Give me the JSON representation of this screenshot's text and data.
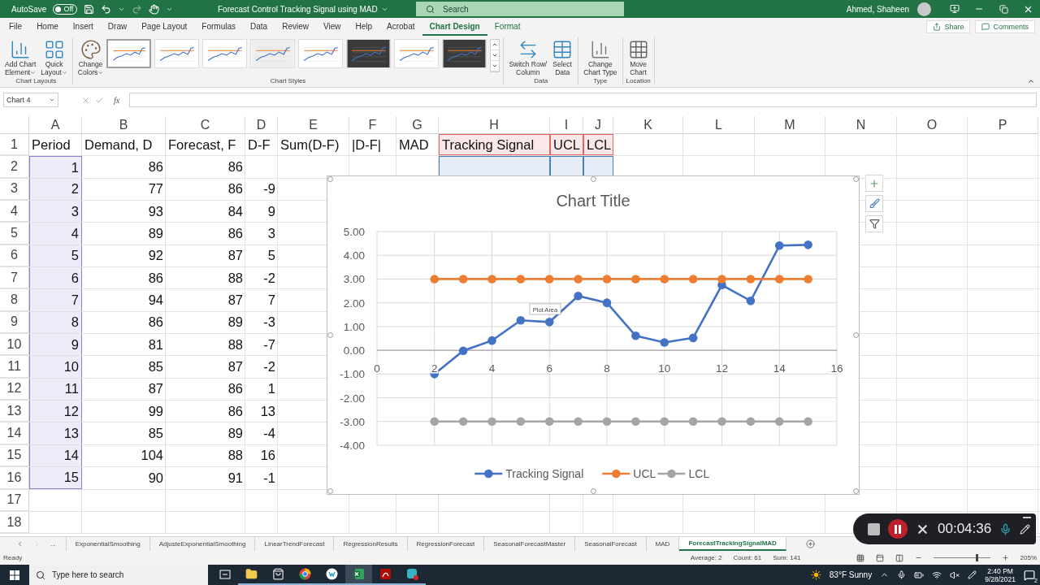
{
  "title_bar": {
    "autosave_label": "AutoSave",
    "autosave": {
      "on": false,
      "label": "Off"
    },
    "title": "Forecast Control Tracking Signal using MAD",
    "search": {
      "placeholder": "Search"
    },
    "user": "Ahmed, Shaheen"
  },
  "menu_tabs": [
    {
      "label": "File",
      "selected": false,
      "kind": "normal"
    },
    {
      "label": "Home",
      "selected": false,
      "kind": "normal"
    },
    {
      "label": "Insert",
      "selected": false,
      "kind": "normal"
    },
    {
      "label": "Draw",
      "selected": false,
      "kind": "normal"
    },
    {
      "label": "Page Layout",
      "selected": false,
      "kind": "normal"
    },
    {
      "label": "Formulas",
      "selected": false,
      "kind": "normal"
    },
    {
      "label": "Data",
      "selected": false,
      "kind": "normal"
    },
    {
      "label": "Review",
      "selected": false,
      "kind": "normal"
    },
    {
      "label": "View",
      "selected": false,
      "kind": "normal"
    },
    {
      "label": "Help",
      "selected": false,
      "kind": "normal"
    },
    {
      "label": "Acrobat",
      "selected": false,
      "kind": "normal"
    },
    {
      "label": "Chart Design",
      "selected": true,
      "kind": "contextual"
    },
    {
      "label": "Format",
      "selected": false,
      "kind": "contextual"
    }
  ],
  "share": "Share",
  "comments": "Comments",
  "ribbon": {
    "groups": [
      {
        "label": "Chart Layouts",
        "commands": [
          {
            "kind": "add-chart",
            "lines": [
              "Add Chart",
              "Element"
            ],
            "dropdown": true
          },
          {
            "kind": "quick-layout",
            "lines": [
              "Quick",
              "Layout"
            ],
            "dropdown": true
          }
        ]
      },
      {
        "label": "Chart Styles",
        "commands": [
          {
            "kind": "colors",
            "lines": [
              "Change",
              "Colors"
            ],
            "dropdown": true
          }
        ],
        "styles": [
          {
            "kind": "light",
            "selected": true
          },
          {
            "kind": "light",
            "selected": false
          },
          {
            "kind": "light",
            "selected": false
          },
          {
            "kind": "shaded",
            "selected": false
          },
          {
            "kind": "light",
            "selected": false
          },
          {
            "kind": "dark",
            "selected": false
          },
          {
            "kind": "light",
            "selected": false
          },
          {
            "kind": "dark",
            "selected": false
          }
        ]
      },
      {
        "label": "Data",
        "commands": [
          {
            "kind": "switch",
            "lines": [
              "Switch Row/",
              "Column"
            ],
            "dropdown": false
          },
          {
            "kind": "select-data",
            "lines": [
              "Select",
              "Data"
            ],
            "dropdown": false
          }
        ]
      },
      {
        "label": "Type",
        "commands": [
          {
            "kind": "chart-type",
            "lines": [
              "Change",
              "Chart Type"
            ],
            "dropdown": false
          }
        ]
      },
      {
        "label": "Location",
        "commands": [
          {
            "kind": "move",
            "lines": [
              "Move",
              "Chart"
            ],
            "dropdown": false
          }
        ]
      }
    ]
  },
  "formula_bar": {
    "name_box": "Chart 4",
    "function_label": "fx"
  },
  "sheet": {
    "columns": [
      {
        "label": "A",
        "color": "#8c7fd0"
      },
      {
        "label": "B"
      },
      {
        "label": "C"
      },
      {
        "label": "D"
      },
      {
        "label": "E"
      },
      {
        "label": "F"
      },
      {
        "label": "G"
      },
      {
        "label": "H",
        "color": "#4a7ebb"
      },
      {
        "label": "I",
        "color": "#4a7ebb"
      },
      {
        "label": "J",
        "color": "#4a7ebb"
      },
      {
        "label": "K"
      },
      {
        "label": "L"
      },
      {
        "label": "M"
      },
      {
        "label": "N"
      },
      {
        "label": "O"
      },
      {
        "label": "P"
      }
    ],
    "rows": [
      {
        "number": "1",
        "kind": "header",
        "cells": [
          {
            "text": "Period"
          },
          {
            "text": "Demand, D"
          },
          {
            "text": "Forecast, F"
          },
          {
            "text": "D-F"
          },
          {
            "text": "Sum(D-F)"
          },
          {
            "text": "|D-F|"
          },
          {
            "text": "MAD"
          },
          {
            "text": "Tracking Signal",
            "color": "#e06666"
          },
          {
            "text": "UCL",
            "color": "#e06666"
          },
          {
            "text": "LCL",
            "color": "#e06666"
          }
        ]
      },
      {
        "number": "2",
        "kind": "data",
        "cells": [
          "1",
          "86",
          "86"
        ]
      },
      {
        "number": "3",
        "kind": "data",
        "cells": [
          "2",
          "77",
          "86",
          "-9"
        ]
      },
      {
        "number": "4",
        "kind": "data",
        "cells": [
          "3",
          "93",
          "84",
          "9"
        ]
      },
      {
        "number": "5",
        "kind": "data",
        "cells": [
          "4",
          "89",
          "86",
          "3"
        ]
      },
      {
        "number": "6",
        "kind": "data",
        "cells": [
          "5",
          "92",
          "87",
          "5"
        ]
      },
      {
        "number": "7",
        "kind": "data",
        "cells": [
          "6",
          "86",
          "88",
          "-2"
        ]
      },
      {
        "number": "8",
        "kind": "data",
        "cells": [
          "7",
          "94",
          "87",
          "7"
        ]
      },
      {
        "number": "9",
        "kind": "data",
        "cells": [
          "8",
          "86",
          "89",
          "-3"
        ]
      },
      {
        "number": "10",
        "kind": "data",
        "cells": [
          "9",
          "81",
          "88",
          "-7"
        ]
      },
      {
        "number": "11",
        "kind": "data",
        "cells": [
          "10",
          "85",
          "87",
          "-2"
        ]
      },
      {
        "number": "12",
        "kind": "data",
        "cells": [
          "11",
          "87",
          "86",
          "1"
        ]
      },
      {
        "number": "13",
        "kind": "data",
        "cells": [
          "12",
          "99",
          "86",
          "13"
        ]
      },
      {
        "number": "14",
        "kind": "data",
        "cells": [
          "13",
          "85",
          "89",
          "-4"
        ]
      },
      {
        "number": "15",
        "kind": "data",
        "cells": [
          "14",
          "104",
          "88",
          "16"
        ]
      },
      {
        "number": "16",
        "kind": "data",
        "cells": [
          "15",
          "90",
          "91",
          "-1"
        ]
      },
      {
        "number": "17"
      },
      {
        "number": "18"
      }
    ]
  },
  "chart": {
    "title": "Chart Title",
    "tooltip": "Plot Area",
    "chart_data": {
      "type": "line",
      "x": [
        2,
        3,
        4,
        5,
        6,
        7,
        8,
        9,
        10,
        11,
        12,
        13,
        14,
        15
      ],
      "series": [
        {
          "name": "Tracking Signal",
          "color": "#4472c4",
          "marker": "circle",
          "values": [
            -1.0,
            -0.02,
            0.41,
            1.26,
            1.19,
            2.29,
            2.0,
            0.61,
            0.33,
            0.52,
            2.75,
            2.08,
            4.41,
            4.44
          ]
        },
        {
          "name": "UCL",
          "color": "#ed7d31",
          "marker": "circle",
          "values": [
            3,
            3,
            3,
            3,
            3,
            3,
            3,
            3,
            3,
            3,
            3,
            3,
            3,
            3
          ]
        },
        {
          "name": "LCL",
          "color": "#a5a5a5",
          "marker": "circle",
          "values": [
            -3,
            -3,
            -3,
            -3,
            -3,
            -3,
            -3,
            -3,
            -3,
            -3,
            -3,
            -3,
            -3,
            -3
          ]
        }
      ],
      "xlim": [
        0,
        16
      ],
      "ylim": [
        -4,
        5
      ],
      "xticks": [
        0,
        2,
        4,
        6,
        8,
        10,
        12,
        14,
        16
      ],
      "yticks": [
        {
          "value": -4,
          "label": "-4.00"
        },
        {
          "value": -3,
          "label": "-3.00"
        },
        {
          "value": -2,
          "label": "-2.00"
        },
        {
          "value": -1,
          "label": "-1.00"
        },
        {
          "value": 0,
          "label": "0.00"
        },
        {
          "value": 1,
          "label": "1.00"
        },
        {
          "value": 2,
          "label": "2.00"
        },
        {
          "value": 3,
          "label": "3.00"
        },
        {
          "value": 4,
          "label": "4.00"
        },
        {
          "value": 5,
          "label": "5.00"
        }
      ],
      "grid": true,
      "legend": true
    }
  },
  "sheet_tabs": {
    "overflow": "...",
    "items": [
      {
        "label": "ExponentialSmoothing",
        "selected": false
      },
      {
        "label": "AdjusteExponentialSmoothing",
        "selected": false
      },
      {
        "label": "LinearTrendForecast",
        "selected": false
      },
      {
        "label": "RegressionResults",
        "selected": false
      },
      {
        "label": "RegressionForecast",
        "selected": false
      },
      {
        "label": "SeasonalForecastMaster",
        "selected": false
      },
      {
        "label": "SeasonalForecast",
        "selected": false
      },
      {
        "label": "MAD",
        "selected": false
      },
      {
        "label": "ForecastTrackingSignalMAD",
        "selected": true
      }
    ]
  },
  "status_bar": {
    "mode": "Ready",
    "stats": [
      "Average: 2",
      "Count: 61",
      "Sum: 141"
    ],
    "zoom_slider": {
      "level": 0.77
    },
    "zoom": "205%"
  },
  "taskbar": {
    "search_placeholder": "Type here to search",
    "apps": [
      {
        "kind": "task-view",
        "running": false,
        "selected": false
      },
      {
        "kind": "folder",
        "running": true,
        "selected": false
      },
      {
        "kind": "store",
        "running": true,
        "selected": false
      },
      {
        "kind": "browser",
        "running": true,
        "selected": false
      },
      {
        "kind": "circle-app",
        "running": true,
        "selected": false
      },
      {
        "kind": "spreadsheet",
        "running": true,
        "selected": true
      },
      {
        "kind": "pdf",
        "running": true,
        "selected": false
      },
      {
        "kind": "recorder",
        "running": true,
        "selected": false
      }
    ],
    "weather": "83°F Sunny",
    "time": "2:40 PM",
    "date": "9/28/2021",
    "notifications": "2"
  },
  "recorder": {
    "timer": "00:04:36"
  }
}
